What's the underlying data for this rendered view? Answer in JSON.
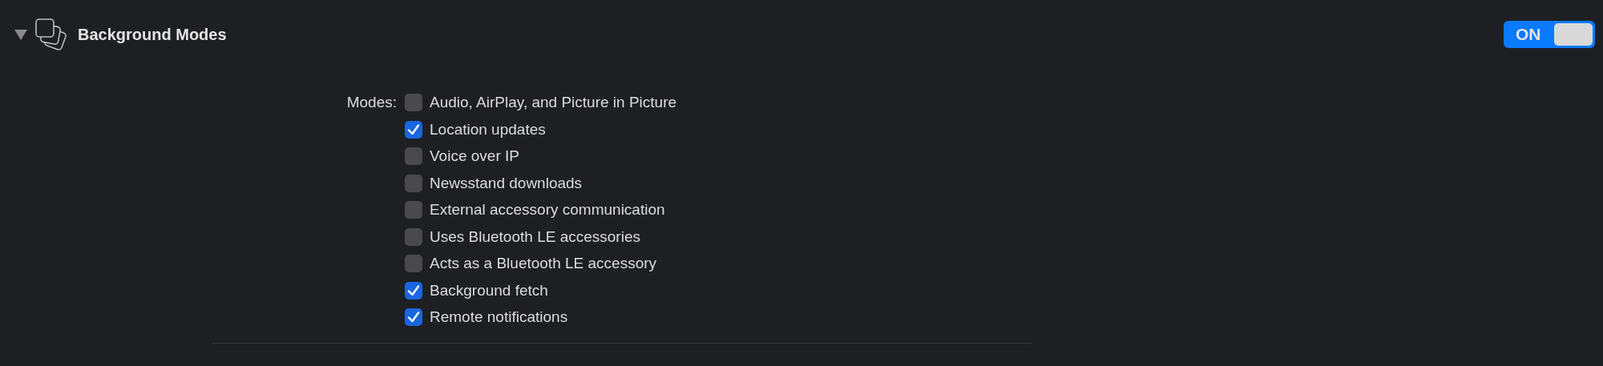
{
  "section": {
    "title": "Background Modes",
    "expanded": true,
    "switch": {
      "label": "ON",
      "on": true
    }
  },
  "modes": {
    "label": "Modes:",
    "options": [
      {
        "label": "Audio, AirPlay, and Picture in Picture",
        "checked": false
      },
      {
        "label": "Location updates",
        "checked": true
      },
      {
        "label": "Voice over IP",
        "checked": false
      },
      {
        "label": "Newsstand downloads",
        "checked": false
      },
      {
        "label": "External accessory communication",
        "checked": false
      },
      {
        "label": "Uses Bluetooth LE accessories",
        "checked": false
      },
      {
        "label": "Acts as a Bluetooth LE accessory",
        "checked": false
      },
      {
        "label": "Background fetch",
        "checked": true
      },
      {
        "label": "Remote notifications",
        "checked": true
      }
    ]
  }
}
